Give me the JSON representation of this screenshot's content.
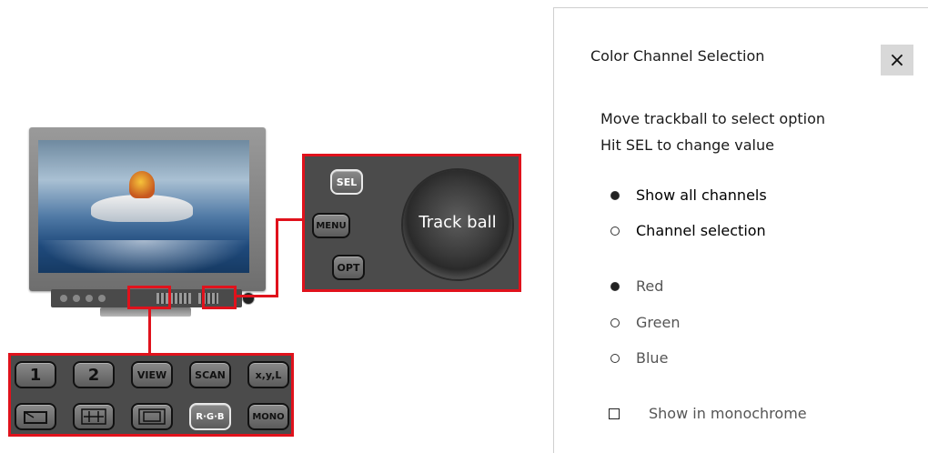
{
  "monitor": {
    "trackball_panel": {
      "buttons": {
        "sel": "SEL",
        "menu": "MENU",
        "opt": "OPT"
      },
      "trackball_label": "Track ball"
    },
    "button_panel": {
      "row1": [
        "1",
        "2",
        "VIEW",
        "SCAN",
        "x,y,L"
      ],
      "row2_mid": "R·G·B",
      "row2_last": "MONO"
    }
  },
  "dialog": {
    "title": "Color Channel Selection",
    "close_label": "×",
    "instructions": [
      "Move trackball to select option",
      "Hit SEL to change value"
    ],
    "modes": [
      {
        "label": "Show all channels",
        "selected": true
      },
      {
        "label": "Channel selection",
        "selected": false
      }
    ],
    "channels": [
      {
        "label": "Red",
        "selected": true
      },
      {
        "label": "Green",
        "selected": false
      },
      {
        "label": "Blue",
        "selected": false
      }
    ],
    "monochrome": {
      "label": "Show in monochrome",
      "checked": false
    }
  }
}
